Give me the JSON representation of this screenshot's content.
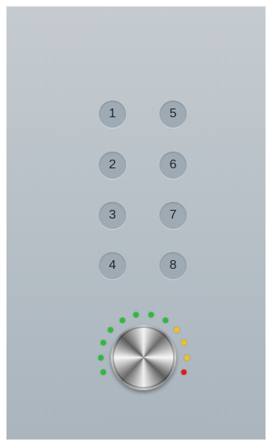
{
  "buttons": [
    {
      "label": "1"
    },
    {
      "label": "2"
    },
    {
      "label": "3"
    },
    {
      "label": "4"
    },
    {
      "label": "5"
    },
    {
      "label": "6"
    },
    {
      "label": "7"
    },
    {
      "label": "8"
    }
  ],
  "knob": {
    "level": 0.75,
    "led_count": 12,
    "colors": {
      "green": "#2dbb3a",
      "yellow": "#f2c21b",
      "red": "#e11b1b"
    }
  }
}
